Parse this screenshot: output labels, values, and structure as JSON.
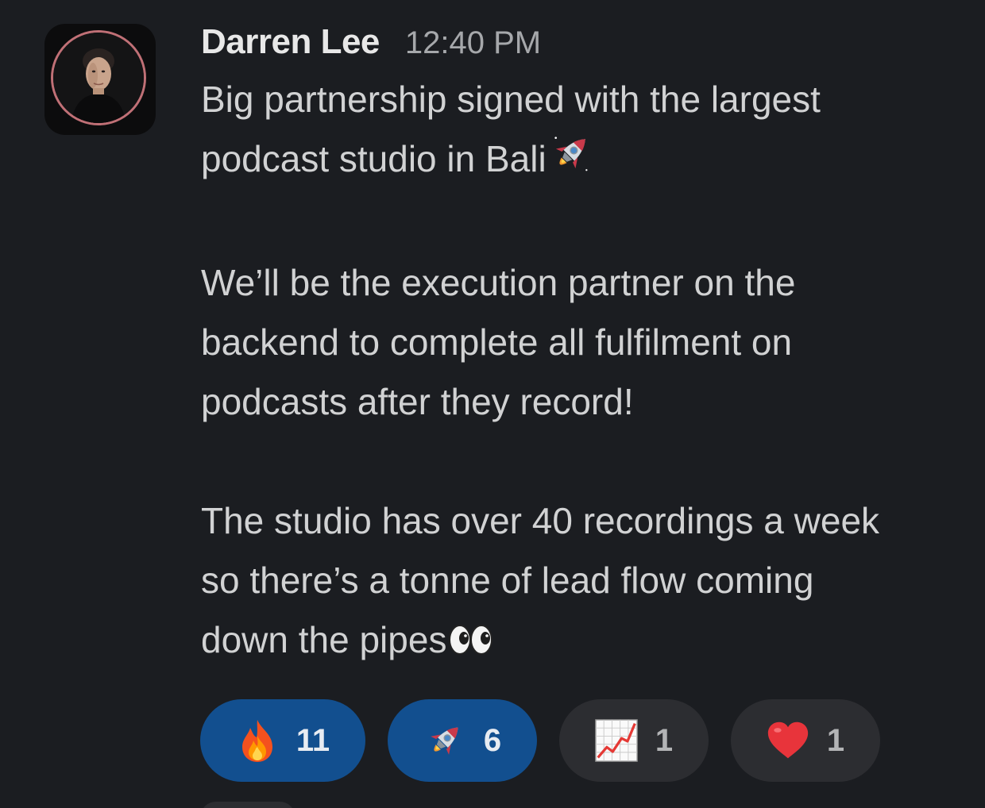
{
  "message": {
    "author": "Darren Lee",
    "time": "12:40 PM",
    "paragraphs": [
      {
        "lines": [
          "Big partnership signed with the largest",
          "podcast studio in Bali"
        ],
        "trailing_emoji": "rocket"
      },
      {
        "lines": [
          "We’ll be the execution partner on the",
          "backend to complete all fulfilment on",
          "podcasts after they record!"
        ],
        "trailing_emoji": null
      },
      {
        "lines": [
          "The studio has over 40 recordings a week",
          "so there’s a tonne of lead flow coming",
          "down the pipes"
        ],
        "trailing_emoji": "eyes"
      }
    ]
  },
  "reactions": [
    {
      "emoji": "fire",
      "count": "11",
      "active": true
    },
    {
      "emoji": "rocket",
      "count": "6",
      "active": true
    },
    {
      "emoji": "chart-increasing",
      "count": "1",
      "active": false
    },
    {
      "emoji": "red-heart",
      "count": "1",
      "active": false
    }
  ],
  "colors": {
    "background": "#1b1d21",
    "active_reaction": "#124f8f",
    "inactive_reaction": "#2c2d31",
    "author": "#e8e8e8",
    "text": "#d1d2d3",
    "timestamp": "#a6a8ab"
  }
}
